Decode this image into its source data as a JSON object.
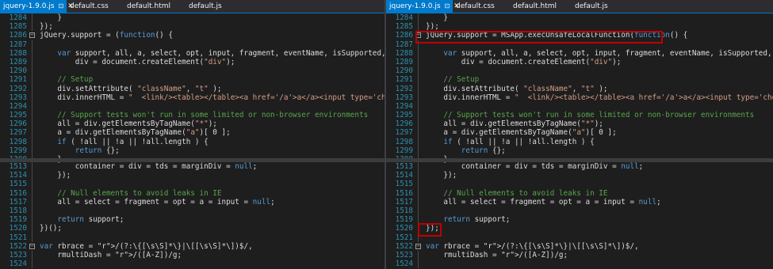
{
  "left_pane": {
    "tabs": [
      {
        "label": "jquery-1.9.0.js",
        "active": true,
        "pin": "⊡",
        "close": "✕"
      },
      {
        "label": "default.css",
        "active": false
      },
      {
        "label": "default.html",
        "active": false
      },
      {
        "label": "default.js",
        "active": false
      }
    ],
    "top_lines": [
      {
        "n": "1284",
        "t": "    }",
        "fold": false
      },
      {
        "n": "1285",
        "t": "});",
        "fold": false
      },
      {
        "n": "1286",
        "t": "jQuery.support = (function() {",
        "fold": true
      },
      {
        "n": "1287",
        "t": "",
        "fold": false
      },
      {
        "n": "1288",
        "t": "    var support, all, a, select, opt, input, fragment, eventName, isSupported, i,",
        "fold": false
      },
      {
        "n": "1289",
        "t": "        div = document.createElement(\"div\");",
        "fold": false
      },
      {
        "n": "1290",
        "t": "",
        "fold": false
      },
      {
        "n": "1291",
        "t": "    // Setup",
        "fold": false
      },
      {
        "n": "1292",
        "t": "    div.setAttribute( \"className\", \"t\" );",
        "fold": false
      },
      {
        "n": "1293",
        "t": "    div.innerHTML = \"  <link/><table></table><a href='/a'>a</a><input type='checkbox'/>\";",
        "fold": false
      },
      {
        "n": "1294",
        "t": "",
        "fold": false
      },
      {
        "n": "1295",
        "t": "    // Support tests won't run in some limited or non-browser environments",
        "fold": false
      },
      {
        "n": "1296",
        "t": "    all = div.getElementsByTagName(\"*\");",
        "fold": false
      },
      {
        "n": "1297",
        "t": "    a = div.getElementsByTagName(\"a\")[ 0 ];",
        "fold": false
      },
      {
        "n": "1298",
        "t": "    if ( !all || !a || !all.length ) {",
        "fold": false
      },
      {
        "n": "1299",
        "t": "        return {};",
        "fold": false
      },
      {
        "n": "1300",
        "t": "    }",
        "fold": false
      }
    ],
    "bottom_lines": [
      {
        "n": "1513",
        "t": "        container = div = tds = marginDiv = null;",
        "fold": false
      },
      {
        "n": "1514",
        "t": "    });",
        "fold": false
      },
      {
        "n": "1515",
        "t": "",
        "fold": false
      },
      {
        "n": "1516",
        "t": "    // Null elements to avoid leaks in IE",
        "fold": false
      },
      {
        "n": "1517",
        "t": "    all = select = fragment = opt = a = input = null;",
        "fold": false
      },
      {
        "n": "1518",
        "t": "",
        "fold": false
      },
      {
        "n": "1519",
        "t": "    return support;",
        "fold": false
      },
      {
        "n": "1520",
        "t": "})();",
        "fold": false
      },
      {
        "n": "1521",
        "t": "",
        "fold": false
      },
      {
        "n": "1522",
        "t": "var rbrace = /(?:\\{[\\s\\S]*\\}|\\[[\\s\\S]*\\])$/,",
        "fold": true
      },
      {
        "n": "1523",
        "t": "    rmultiDash = /([A-Z])/g;",
        "fold": false
      },
      {
        "n": "1524",
        "t": "",
        "fold": false
      }
    ]
  },
  "right_pane": {
    "tabs": [
      {
        "label": "jquery-1.9.0.js",
        "active": true,
        "pin": "⊡",
        "close": "✕"
      },
      {
        "label": "default.css",
        "active": false
      },
      {
        "label": "default.html",
        "active": false
      },
      {
        "label": "default.js",
        "active": false
      }
    ],
    "top_lines": [
      {
        "n": "1284",
        "t": "    }",
        "fold": false
      },
      {
        "n": "1285",
        "t": "});",
        "fold": false
      },
      {
        "n": "1286",
        "t": "jQuery.support = MSApp.execUnsafeLocalFunction(function() {",
        "fold": true
      },
      {
        "n": "1287",
        "t": "",
        "fold": false
      },
      {
        "n": "1288",
        "t": "    var support, all, a, select, opt, input, fragment, eventName, isSupported, i,",
        "fold": false
      },
      {
        "n": "1289",
        "t": "        div = document.createElement(\"div\");",
        "fold": false
      },
      {
        "n": "1290",
        "t": "",
        "fold": false
      },
      {
        "n": "1291",
        "t": "    // Setup",
        "fold": false
      },
      {
        "n": "1292",
        "t": "    div.setAttribute( \"className\", \"t\" );",
        "fold": false
      },
      {
        "n": "1293",
        "t": "    div.innerHTML = \"  <link/><table></table><a href='/a'>a</a><input type='checkbox'/>\";",
        "fold": false
      },
      {
        "n": "1294",
        "t": "",
        "fold": false
      },
      {
        "n": "1295",
        "t": "    // Support tests won't run in some limited or non-browser environments",
        "fold": false
      },
      {
        "n": "1296",
        "t": "    all = div.getElementsByTagName(\"*\");",
        "fold": false
      },
      {
        "n": "1297",
        "t": "    a = div.getElementsByTagName(\"a\")[ 0 ];",
        "fold": false
      },
      {
        "n": "1298",
        "t": "    if ( !all || !a || !all.length ) {",
        "fold": false
      },
      {
        "n": "1299",
        "t": "        return {};",
        "fold": false
      },
      {
        "n": "1300",
        "t": "    }",
        "fold": false
      }
    ],
    "bottom_lines": [
      {
        "n": "1513",
        "t": "        container = div = tds = marginDiv = null;",
        "fold": false
      },
      {
        "n": "1514",
        "t": "    });",
        "fold": false
      },
      {
        "n": "1515",
        "t": "",
        "fold": false
      },
      {
        "n": "1516",
        "t": "    // Null elements to avoid leaks in IE",
        "fold": false
      },
      {
        "n": "1517",
        "t": "    all = select = fragment = opt = a = input = null;",
        "fold": false
      },
      {
        "n": "1518",
        "t": "",
        "fold": false
      },
      {
        "n": "1519",
        "t": "    return support;",
        "fold": false
      },
      {
        "n": "1520",
        "t": "});",
        "fold": false
      },
      {
        "n": "1521",
        "t": "",
        "fold": false
      },
      {
        "n": "1522",
        "t": "var rbrace = /(?:\\{[\\s\\S]*\\}|\\[[\\s\\S]*\\])$/,",
        "fold": true
      },
      {
        "n": "1523",
        "t": "    rmultiDash = /([A-Z])/g;",
        "fold": false
      },
      {
        "n": "1524",
        "t": "",
        "fold": false
      }
    ]
  },
  "colors": {
    "accent": "#007acc",
    "highlight_box": "#c00000",
    "keyword": "#569cd6",
    "string": "#d69d85",
    "comment": "#57a64a",
    "regex": "#d16969",
    "line_number": "#2b91af"
  }
}
